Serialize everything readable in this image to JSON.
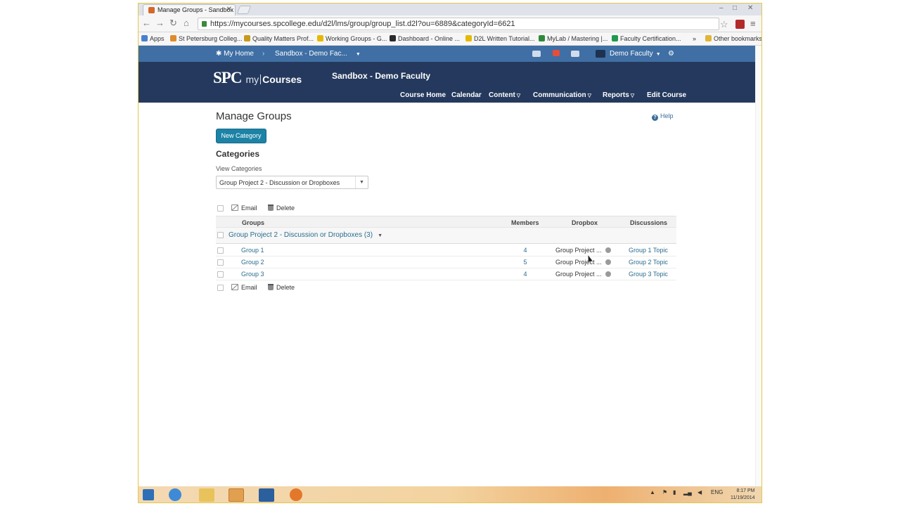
{
  "browser": {
    "tab_title": "Manage Groups - Sandbox",
    "tab_close": "✕",
    "url": "https://mycourses.spcollege.edu/d2l/lms/group/group_list.d2l?ou=6889&categoryId=6621",
    "bookmarks": [
      {
        "label": "Apps",
        "color": "#4a7fd0"
      },
      {
        "label": "St Petersburg Colleg...",
        "color": "#e08a2a"
      },
      {
        "label": "Quality Matters Prof...",
        "color": "#c79a1e"
      },
      {
        "label": "Working Groups - G...",
        "color": "#e6b800"
      },
      {
        "label": "Dashboard - Online ...",
        "color": "#2a2a2a"
      },
      {
        "label": "D2L Written Tutorial...",
        "color": "#e6b800"
      },
      {
        "label": "MyLab / Mastering |...",
        "color": "#2d8a3a"
      },
      {
        "label": "Faculty Certification...",
        "color": "#1d9a4d"
      },
      {
        "label": "Other bookmarks",
        "color": "#e2b437"
      }
    ],
    "overflow_chevron": "»"
  },
  "minibar": {
    "home": "My Home",
    "course_switch": "Sandbox - Demo Fac...",
    "user": "Demo Faculty"
  },
  "header": {
    "logo_spc": "SPC",
    "logo_my": "my",
    "logo_courses": "Courses",
    "course_title": "Sandbox - Demo Faculty",
    "nav": [
      "Course Home",
      "Calendar",
      "Content",
      "Communication",
      "Reports",
      "Edit Course"
    ]
  },
  "page": {
    "title": "Manage Groups",
    "help": "Help",
    "new_category": "New Category",
    "categories_title": "Categories",
    "view_categories_label": "View Categories",
    "selected_category": "Group Project 2 - Discussion or Dropboxes",
    "email": "Email",
    "delete": "Delete",
    "columns": {
      "groups": "Groups",
      "members": "Members",
      "dropbox": "Dropbox",
      "discussions": "Discussions"
    },
    "category_row": "Group Project 2 - Discussion or Dropboxes (3)",
    "groups": [
      {
        "name": "Group 1",
        "members": "4",
        "dropbox": "Group Project ...",
        "discussion": "Group 1 Topic"
      },
      {
        "name": "Group 2",
        "members": "5",
        "dropbox": "Group Project ...",
        "discussion": "Group 2 Topic"
      },
      {
        "name": "Group 3",
        "members": "4",
        "dropbox": "Group Project ...",
        "discussion": "Group 3 Topic"
      }
    ]
  },
  "taskbar": {
    "lang": "ENG",
    "time": "8:17 PM",
    "date": "11/19/2014"
  },
  "colors": {
    "minibar": "#3f6fa4",
    "header": "#24395d",
    "primary_button": "#1d83a6",
    "link": "#2a6d8f"
  },
  "icons": [
    "waffle-icon",
    "breadcrumb-chevron-icon",
    "message-icon",
    "alert-icon",
    "chat-icon",
    "user-avatar-icon",
    "settings-icon",
    "help-icon",
    "email-icon",
    "trash-icon",
    "info-icon",
    "star-icon",
    "lock-icon"
  ]
}
